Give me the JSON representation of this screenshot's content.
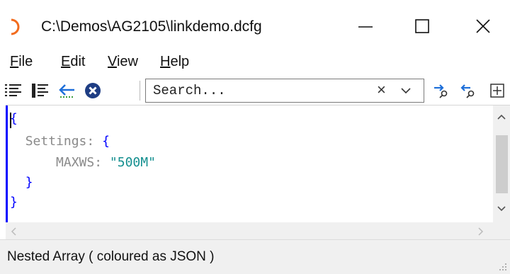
{
  "window": {
    "title": "C:\\Demos\\AG2105\\linkdemo.dcfg",
    "accent_color": "#f26b1d"
  },
  "menu": {
    "items": [
      {
        "underline": "F",
        "rest": "ile"
      },
      {
        "underline": "E",
        "rest": "dit"
      },
      {
        "underline": "V",
        "rest": "iew"
      },
      {
        "underline": "H",
        "rest": "elp"
      }
    ]
  },
  "toolbar": {
    "icons": [
      "align-left-icon",
      "list-indent-icon",
      "back-arrow-icon",
      "close-circle-icon",
      "find-next-icon",
      "find-previous-icon",
      "expand-box-icon"
    ],
    "search_placeholder": "Search...",
    "clear_glyph": "×"
  },
  "editor": {
    "lines": [
      {
        "indent": "",
        "open": "{",
        "key": "",
        "colon": "",
        "value": "",
        "close": ""
      },
      {
        "indent": "  ",
        "open": "",
        "key": "Settings",
        "colon": ": ",
        "value": "",
        "close": "{"
      },
      {
        "indent": "      ",
        "open": "",
        "key": "MAXWS",
        "colon": ": ",
        "value": "\"500M\"",
        "close": ""
      },
      {
        "indent": "  ",
        "open": "",
        "key": "",
        "colon": "",
        "value": "",
        "close": "}"
      },
      {
        "indent": "",
        "open": "",
        "key": "",
        "colon": "",
        "value": "",
        "close": "}"
      }
    ],
    "colors": {
      "brace": "#0000ff",
      "key": "#8a8a8a",
      "string": "#148f8f"
    }
  },
  "status": {
    "text": "Nested Array ( coloured as JSON )"
  }
}
